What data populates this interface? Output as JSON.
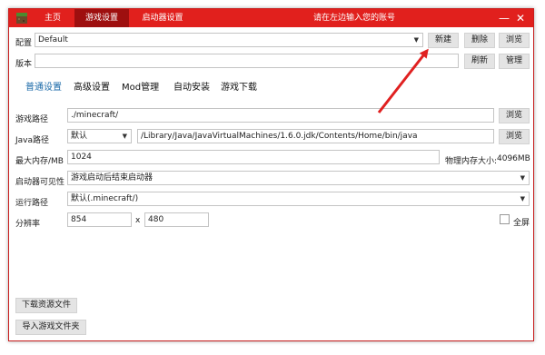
{
  "titlebar": {
    "tabs": [
      "主页",
      "游戏设置",
      "启动器设置"
    ],
    "active_tab": 1,
    "title": "请在左边输入您的账号",
    "minimize": "—",
    "close": "✕"
  },
  "profile": {
    "label": "配置",
    "value": "Default",
    "new_button": "新建",
    "delete_button": "删除",
    "browse_button": "浏览"
  },
  "version": {
    "label": "版本",
    "value": "",
    "refresh_button": "刷新",
    "manage_button": "管理"
  },
  "subtabs": [
    "普通设置",
    "高级设置",
    "Mod管理",
    "自动安装",
    "游戏下载"
  ],
  "active_subtab": 0,
  "game_path": {
    "label": "游戏路径",
    "value": "./minecraft/",
    "browse_button": "浏览"
  },
  "java_path": {
    "label": "Java路径",
    "mode": "默认",
    "value": "/Library/Java/JavaVirtualMachines/1.6.0.jdk/Contents/Home/bin/java",
    "browse_button": "浏览"
  },
  "max_memory": {
    "label": "最大内存/MB",
    "value": "1024",
    "physical_label": "物理内存大小:",
    "physical_value": "4096MB"
  },
  "launcher_visibility": {
    "label": "启动器可见性",
    "value": "游戏启动后结束启动器"
  },
  "run_path": {
    "label": "运行路径",
    "value": "默认(.minecraft/)"
  },
  "resolution": {
    "label": "分辨率",
    "width": "854",
    "separator": "x",
    "height": "480",
    "fullscreen_label": "全屏",
    "fullscreen_checked": false
  },
  "bottom_buttons": {
    "download_resources": "下载资源文件",
    "import_game_folder": "导入游戏文件夹"
  },
  "colors": {
    "titlebar": "#e1201d",
    "active_tab": "#9e0f0f",
    "subtab_active": "#1b6aa8",
    "annotation_arrow": "#e02020"
  },
  "icons": {
    "logo": "grass-block-icon",
    "dropdown": "chevron-down-icon"
  }
}
